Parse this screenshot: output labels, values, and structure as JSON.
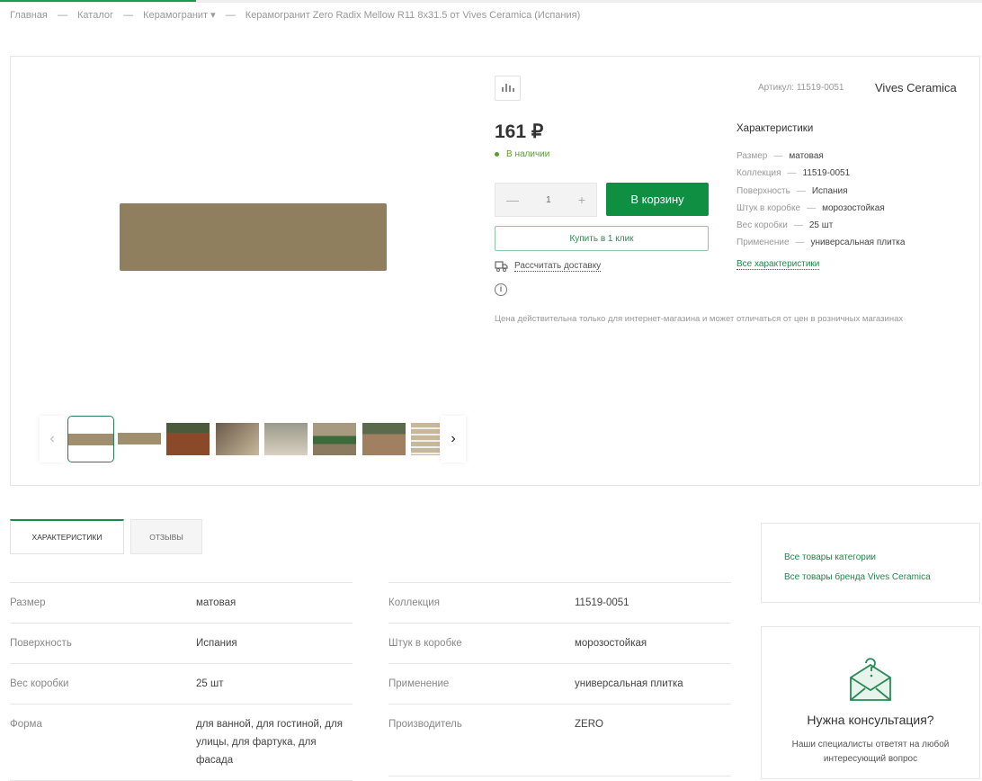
{
  "page_load_progress_percent": 20,
  "breadcrumbs": [
    "Главная",
    "—",
    "Каталог",
    "—",
    "Керамогранит ▾",
    "—",
    "Керамогранит Zero Radix Mellow R11 8x31.5 от Vives Ceramica (Испания)"
  ],
  "product": {
    "article": "Артикул: 11519-0051",
    "brand": "Vives Ceramica",
    "price": "161 ₽",
    "stock": "В наличии",
    "quantity": "1",
    "qty_minus": "—",
    "qty_plus": "+",
    "add_to_cart": "В корзину",
    "buy_one_click": "Купить в 1 клик",
    "delivery": "Рассчитать доставку",
    "info_icon": "i",
    "price_note": "Цена действительна только для интернет-магазина и может отличаться от цен в розничных магазинах",
    "tile_color": "#8f7f5e"
  },
  "gallery": {
    "prev": "‹",
    "next": "›"
  },
  "short_specs": {
    "title": "Характеристики",
    "dash": "—",
    "items": [
      {
        "k": "Размер",
        "v": "матовая"
      },
      {
        "k": "Коллекция",
        "v": "11519-0051"
      },
      {
        "k": "Поверхность",
        "v": "Испания"
      },
      {
        "k": "Штук в коробке",
        "v": "морозостойкая"
      },
      {
        "k": "Вес коробки",
        "v": "25 шт"
      },
      {
        "k": "Применение",
        "v": "универсальная плитка"
      }
    ],
    "all_link": "Все характеристики"
  },
  "tabs": [
    {
      "label": "ХАРАКТЕРИСТИКИ"
    },
    {
      "label": "ОТЗЫВЫ"
    }
  ],
  "specs_left": [
    {
      "k": "Размер",
      "v": "матовая"
    },
    {
      "k": "Поверхность",
      "v": "Испания"
    },
    {
      "k": "Вес коробки",
      "v": "25 шт"
    },
    {
      "k": "Форма",
      "v": "для ванной, для гостиной, для улицы, для фартука, для фасада"
    }
  ],
  "specs_right": [
    {
      "k": "Коллекция",
      "v": "11519-0051"
    },
    {
      "k": "Штук в коробке",
      "v": "морозостойкая"
    },
    {
      "k": "Применение",
      "v": "универсальная плитка"
    },
    {
      "k": "Производитель",
      "v": "ZERO"
    }
  ],
  "sidebar": {
    "links": [
      "Все товары категории",
      "Все товары бренда Vives Ceramica"
    ],
    "consult_title": "Нужна консультация?",
    "consult_text": "Наши специалисты ответят на любой интересующий вопрос"
  },
  "colors": {
    "accent": "#0e8f42",
    "link": "#1a8a4a"
  }
}
